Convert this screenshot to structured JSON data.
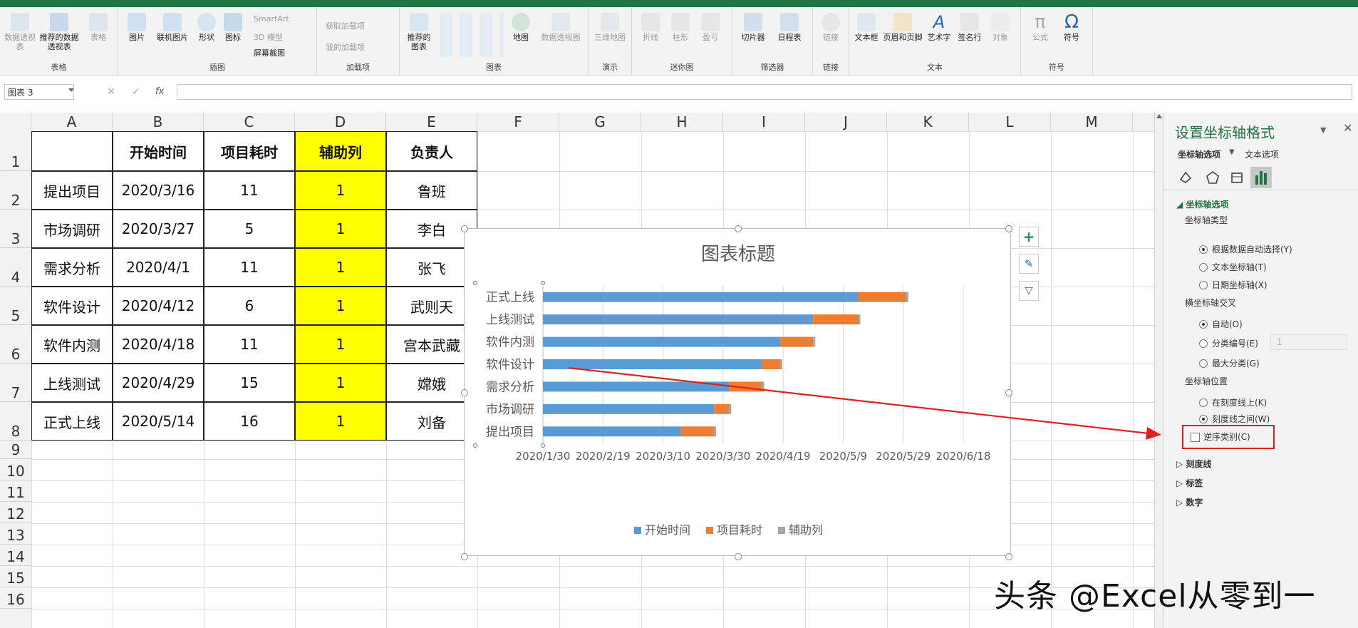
{
  "ribbon": {
    "groups": [
      {
        "label": "表格",
        "buttons": [
          "数据透视表",
          "推荐的数据透视表",
          "表格"
        ]
      },
      {
        "label": "插图",
        "buttons": [
          "图片",
          "联机图片",
          "形状",
          "图标"
        ],
        "small": [
          "SmartArt",
          "3D 模型",
          "屏幕截图"
        ]
      },
      {
        "label": "加载项",
        "small": [
          "获取加载项",
          "我的加载项"
        ]
      },
      {
        "label": "图表",
        "buttons": [
          "推荐的图表",
          "地图",
          "数据透视图"
        ]
      },
      {
        "label": "演示",
        "buttons": [
          "三维地图"
        ]
      },
      {
        "label": "迷你图",
        "buttons": [
          "折线",
          "柱形",
          "盈亏"
        ]
      },
      {
        "label": "筛选器",
        "buttons": [
          "切片器",
          "日程表"
        ]
      },
      {
        "label": "链接",
        "buttons": [
          "链接"
        ]
      },
      {
        "label": "文本",
        "buttons": [
          "文本框",
          "页眉和页脚",
          "艺术字",
          "签名行",
          "对象"
        ]
      },
      {
        "label": "符号",
        "buttons": [
          "公式",
          "符号"
        ]
      }
    ]
  },
  "formula_bar": {
    "name_box": "图表 3",
    "fx": "fx",
    "cancel": "✕",
    "confirm": "✓"
  },
  "columns": [
    "A",
    "B",
    "C",
    "D",
    "E",
    "F",
    "G",
    "H",
    "I",
    "J",
    "K",
    "L",
    "M"
  ],
  "rows": [
    "1",
    "2",
    "3",
    "4",
    "5",
    "6",
    "7",
    "8",
    "9",
    "10",
    "11",
    "12",
    "13",
    "14",
    "15",
    "16"
  ],
  "table": {
    "headers": [
      "",
      "开始时间",
      "项目耗时",
      "辅助列",
      "负责人"
    ],
    "rows": [
      [
        "提出项目",
        "2020/3/16",
        "11",
        "1",
        "鲁班"
      ],
      [
        "市场调研",
        "2020/3/27",
        "5",
        "1",
        "李白"
      ],
      [
        "需求分析",
        "2020/4/1",
        "11",
        "1",
        "张飞"
      ],
      [
        "软件设计",
        "2020/4/12",
        "6",
        "1",
        "武则天"
      ],
      [
        "软件内测",
        "2020/4/18",
        "11",
        "1",
        "宫本武藏"
      ],
      [
        "上线测试",
        "2020/4/29",
        "15",
        "1",
        "嫦娥"
      ],
      [
        "正式上线",
        "2020/5/14",
        "16",
        "1",
        "刘备"
      ]
    ]
  },
  "chart_data": {
    "type": "bar",
    "orientation": "horizontal",
    "stacked": true,
    "title": "图表标题",
    "categories": [
      "正式上线",
      "上线测试",
      "软件内测",
      "软件设计",
      "需求分析",
      "市场调研",
      "提出项目"
    ],
    "series": [
      {
        "name": "开始时间",
        "color": "#5b9bd5",
        "values": [
          "2020/5/14",
          "2020/4/29",
          "2020/4/18",
          "2020/4/12",
          "2020/4/1",
          "2020/3/27",
          "2020/3/16"
        ]
      },
      {
        "name": "项目耗时",
        "color": "#ed7d31",
        "values": [
          16,
          15,
          11,
          6,
          11,
          5,
          11
        ]
      },
      {
        "name": "辅助列",
        "color": "#a5a5a5",
        "values": [
          1,
          1,
          1,
          1,
          1,
          1,
          1
        ]
      }
    ],
    "x_ticks": [
      "2020/1/30",
      "2020/2/19",
      "2020/3/10",
      "2020/3/30",
      "2020/4/19",
      "2020/5/9",
      "2020/5/29",
      "2020/6/18"
    ],
    "xlim": [
      "2020/1/30",
      "2020/6/18"
    ],
    "legend": "bottom",
    "grid": true
  },
  "side_tools": [
    "chart-elements-plus-icon",
    "chart-styles-brush-icon",
    "chart-filter-icon"
  ],
  "pane": {
    "title": "设置坐标轴格式",
    "tab_axis": "坐标轴选项",
    "tab_text": "文本选项",
    "section_axis": "坐标轴选项",
    "axis_type_label": "坐标轴类型",
    "axis_type_options": [
      "根据数据自动选择(Y)",
      "文本坐标轴(T)",
      "日期坐标轴(X)"
    ],
    "axis_type_selected": 0,
    "cross_label": "横坐标轴交叉",
    "cross_options": [
      "自动(O)",
      "分类编号(E)",
      "最大分类(G)"
    ],
    "cross_selected": 0,
    "cross_value": "1",
    "position_label": "坐标轴位置",
    "position_options": [
      "在刻度线上(K)",
      "刻度线之间(W)"
    ],
    "position_selected": 1,
    "reverse_label": "逆序类别(C)",
    "reverse_checked": false,
    "collapsed_sections": [
      "刻度线",
      "标签",
      "数字"
    ]
  },
  "watermark": "头条 @Excel从零到一",
  "colors": {
    "highlight_yellow": "#ffff00",
    "excel_green": "#217346",
    "annotation_red": "#e02020"
  }
}
